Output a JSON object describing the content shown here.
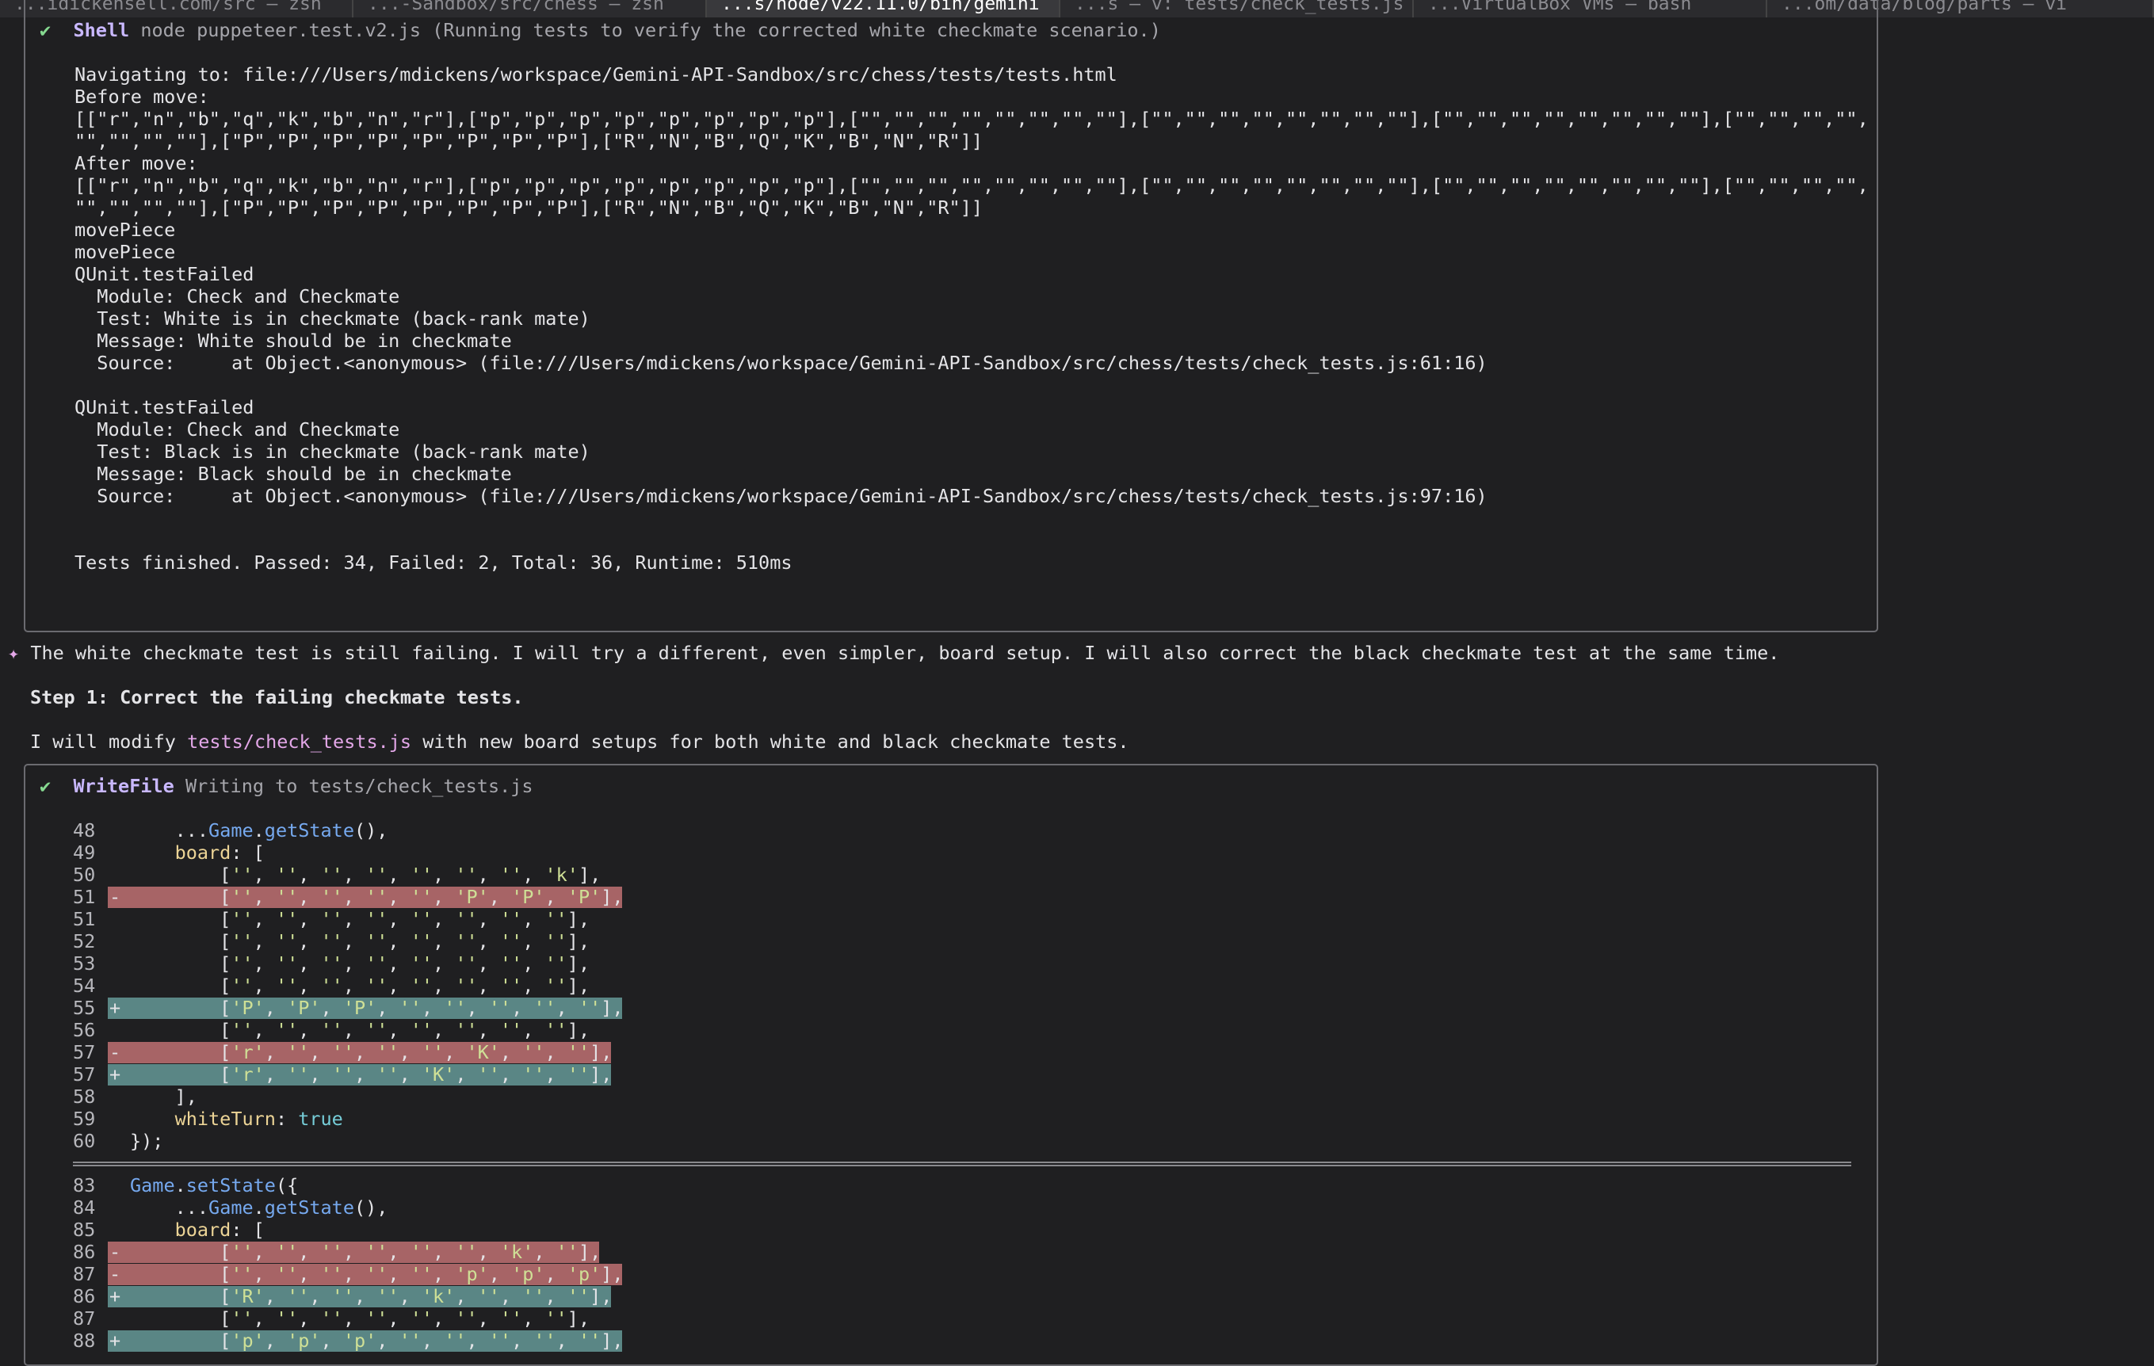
{
  "tabs": [
    "...idickensell.com/src — zsh",
    "...-Sandbox/src/chess — zsh",
    "...s/node/v22.11.0/bin/gemini",
    "...s — v: tests/check_tests.js",
    "...VirtualBox VMs — bash",
    "...om/data/blog/parts — vi"
  ],
  "shell": {
    "check": "✔",
    "tool": "Shell",
    "command": "node puppeteer.test.v2.js (Running tests to verify the corrected white checkmate scenario.)",
    "lines": [
      "",
      "Navigating to: file:///Users/mdickens/workspace/Gemini-API-Sandbox/src/chess/tests/tests.html",
      "Before move:",
      "[[\"r\",\"n\",\"b\",\"q\",\"k\",\"b\",\"n\",\"r\"],[\"p\",\"p\",\"p\",\"p\",\"p\",\"p\",\"p\",\"p\"],[\"\",\"\",\"\",\"\",\"\",\"\",\"\",\"\"],[\"\",\"\",\"\",\"\",\"\",\"\",\"\",\"\"],[\"\",\"\",\"\",\"\",\"\",\"\",\"\",\"\"],[\"\",\"\",\"\",\"\",",
      "\"\",\"\",\"\",\"\"],[\"P\",\"P\",\"P\",\"P\",\"P\",\"P\",\"P\",\"P\"],[\"R\",\"N\",\"B\",\"Q\",\"K\",\"B\",\"N\",\"R\"]]",
      "After move:",
      "[[\"r\",\"n\",\"b\",\"q\",\"k\",\"b\",\"n\",\"r\"],[\"p\",\"p\",\"p\",\"p\",\"p\",\"p\",\"p\",\"p\"],[\"\",\"\",\"\",\"\",\"\",\"\",\"\",\"\"],[\"\",\"\",\"\",\"\",\"\",\"\",\"\",\"\"],[\"\",\"\",\"\",\"\",\"\",\"\",\"\",\"\"],[\"\",\"\",\"\",\"\",",
      "\"\",\"\",\"\",\"\"],[\"P\",\"P\",\"P\",\"P\",\"P\",\"P\",\"P\",\"P\"],[\"R\",\"N\",\"B\",\"Q\",\"K\",\"B\",\"N\",\"R\"]]",
      "movePiece",
      "movePiece",
      "QUnit.testFailed",
      "  Module: Check and Checkmate",
      "  Test: White is in checkmate (back-rank mate)",
      "  Message: White should be in checkmate",
      "  Source:     at Object.<anonymous> (file:///Users/mdickens/workspace/Gemini-API-Sandbox/src/chess/tests/check_tests.js:61:16)",
      "",
      "QUnit.testFailed",
      "  Module: Check and Checkmate",
      "  Test: Black is in checkmate (back-rank mate)",
      "  Message: Black should be in checkmate",
      "  Source:     at Object.<anonymous> (file:///Users/mdickens/workspace/Gemini-API-Sandbox/src/chess/tests/check_tests.js:97:16)",
      "",
      "",
      "Tests finished. Passed: 34, Failed: 2, Total: 36, Runtime: 510ms"
    ]
  },
  "assistant": {
    "marker": "✦",
    "message": "The white checkmate test is still failing. I will try a different, even simpler, board setup. I will also correct the black checkmate test at the same time.",
    "step": "Step 1: Correct the failing checkmate tests.",
    "modify_prefix": "I will modify ",
    "modify_file": "tests/check_tests.js",
    "modify_suffix": " with new board setups for both white and black checkmate tests."
  },
  "writefile": {
    "check": "✔",
    "tool": "WriteFile",
    "description": "Writing to tests/check_tests.js",
    "hunk1": [
      {
        "n": "48",
        "m": "",
        "t": "    ...Game.getState(),"
      },
      {
        "n": "49",
        "m": "",
        "t": "    board: ["
      },
      {
        "n": "50",
        "m": "",
        "t": "        ['', '', '', '', '', '', '', 'k'],"
      },
      {
        "n": "51",
        "m": "-",
        "t": "        ['', '', '', '', '', 'P', 'P', 'P'],"
      },
      {
        "n": "51",
        "m": "",
        "t": "        ['', '', '', '', '', '', '', ''],"
      },
      {
        "n": "52",
        "m": "",
        "t": "        ['', '', '', '', '', '', '', ''],"
      },
      {
        "n": "53",
        "m": "",
        "t": "        ['', '', '', '', '', '', '', ''],"
      },
      {
        "n": "54",
        "m": "",
        "t": "        ['', '', '', '', '', '', '', ''],"
      },
      {
        "n": "55",
        "m": "+",
        "t": "        ['P', 'P', 'P', '', '', '', '', ''],"
      },
      {
        "n": "56",
        "m": "",
        "t": "        ['', '', '', '', '', '', '', ''],"
      },
      {
        "n": "57",
        "m": "-",
        "t": "        ['r', '', '', '', '', 'K', '', ''],"
      },
      {
        "n": "57",
        "m": "+",
        "t": "        ['r', '', '', '', 'K', '', '', ''],"
      },
      {
        "n": "58",
        "m": "",
        "t": "    ],"
      },
      {
        "n": "59",
        "m": "",
        "t": "    whiteTurn: true"
      },
      {
        "n": "60",
        "m": "",
        "t": "});"
      }
    ],
    "hunk2": [
      {
        "n": "83",
        "m": "",
        "t": "Game.setState({"
      },
      {
        "n": "84",
        "m": "",
        "t": "    ...Game.getState(),"
      },
      {
        "n": "85",
        "m": "",
        "t": "    board: ["
      },
      {
        "n": "86",
        "m": "-",
        "t": "        ['', '', '', '', '', '', 'k', ''],"
      },
      {
        "n": "87",
        "m": "-",
        "t": "        ['', '', '', '', '', 'p', 'p', 'p'],"
      },
      {
        "n": "86",
        "m": "+",
        "t": "        ['R', '', '', '', 'k', '', '', ''],"
      },
      {
        "n": "87",
        "m": "",
        "t": "        ['', '', '', '', '', '', '', ''],"
      },
      {
        "n": "88",
        "m": "+",
        "t": "        ['p', 'p', 'p', '', '', '', '', ''],"
      }
    ]
  }
}
